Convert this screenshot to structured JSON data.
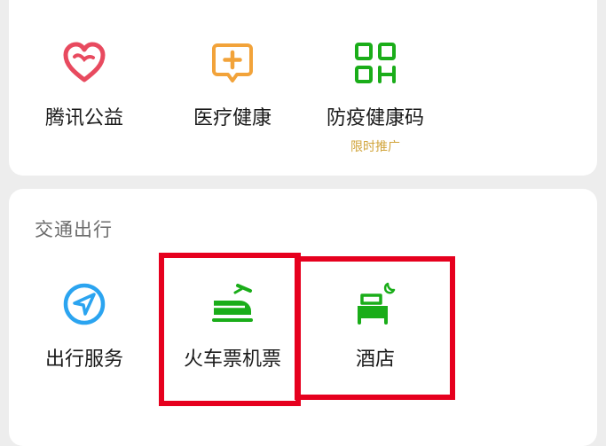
{
  "services": {
    "items": [
      {
        "label": "腾讯公益",
        "icon": "heart-icon",
        "color": "#e84a5f"
      },
      {
        "label": "医疗健康",
        "icon": "medical-chat-icon",
        "color": "#f2a33a"
      },
      {
        "label": "防疫健康码",
        "sub": "限时推广",
        "icon": "qr-code-icon",
        "color": "#1aad19"
      }
    ]
  },
  "transport": {
    "title": "交通出行",
    "items": [
      {
        "label": "出行服务",
        "icon": "navigation-icon",
        "color": "#2ba4f0"
      },
      {
        "label": "火车票机票",
        "icon": "train-plane-icon",
        "color": "#1aad19"
      },
      {
        "label": "酒店",
        "icon": "hotel-bed-icon",
        "color": "#1aad19"
      }
    ]
  },
  "colors": {
    "highlight": "#e6001e",
    "sub_text": "#d1a43a",
    "background": "#ededed"
  }
}
